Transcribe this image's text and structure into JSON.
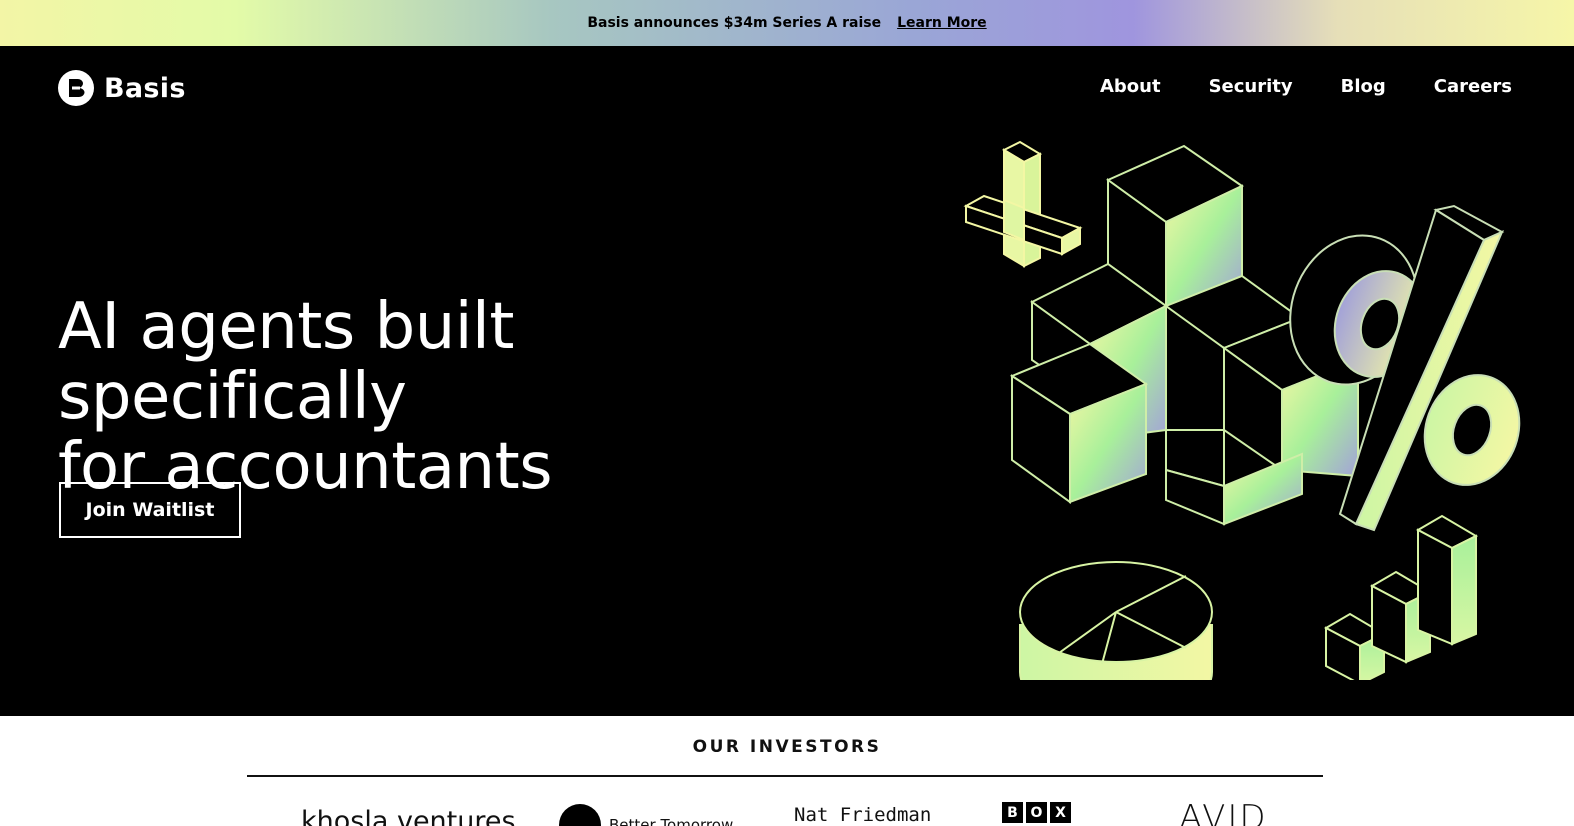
{
  "announcement": {
    "message": "Basis announces $34m Series A raise",
    "link_label": "Learn More"
  },
  "brand": {
    "name": "Basis",
    "logo_icon": "basis-b-logo-icon"
  },
  "nav": {
    "items": [
      {
        "label": "About"
      },
      {
        "label": "Security"
      },
      {
        "label": "Blog"
      },
      {
        "label": "Careers"
      }
    ]
  },
  "hero": {
    "headline_line1": "AI agents built specifically",
    "headline_line2": "for accountants",
    "cta_label": "Join Waitlist",
    "illustration_icons": [
      "plus-icon",
      "blocks-icon",
      "percent-icon",
      "pie-chart-icon",
      "bar-chart-icon"
    ]
  },
  "investors": {
    "title": "OUR INVESTORS",
    "logos": [
      {
        "name": "khosla ventures"
      },
      {
        "name": "Better Tomorrow"
      },
      {
        "name": "Nat Friedman"
      },
      {
        "name": "BOX",
        "letters": [
          "B",
          "O",
          "X"
        ]
      },
      {
        "name": "AVID"
      }
    ]
  },
  "colors": {
    "hero_bg": "#000000",
    "accent_green": "#a8f09a",
    "accent_yellow": "#f3f7a4",
    "accent_lavender": "#a3a2d8"
  }
}
